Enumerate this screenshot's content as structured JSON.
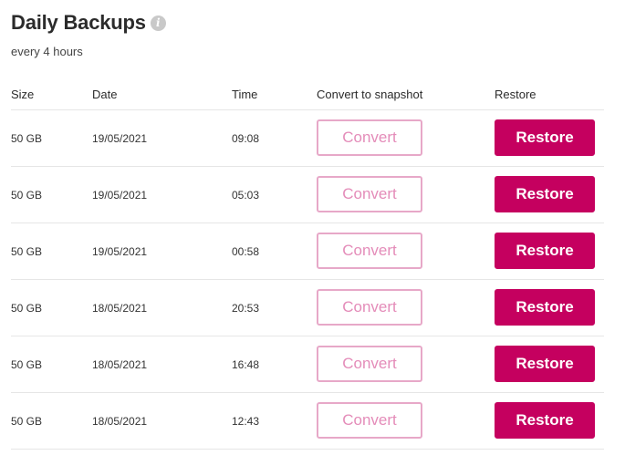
{
  "header": {
    "title": "Daily Backups",
    "info_icon": "info-icon",
    "subtitle": "every 4 hours"
  },
  "table": {
    "columns": {
      "size": "Size",
      "date": "Date",
      "time": "Time",
      "convert": "Convert to snapshot",
      "restore": "Restore"
    },
    "rows": [
      {
        "size": "50 GB",
        "date": "19/05/2021",
        "time": "09:08",
        "convert_label": "Convert",
        "restore_label": "Restore"
      },
      {
        "size": "50 GB",
        "date": "19/05/2021",
        "time": "05:03",
        "convert_label": "Convert",
        "restore_label": "Restore"
      },
      {
        "size": "50 GB",
        "date": "19/05/2021",
        "time": "00:58",
        "convert_label": "Convert",
        "restore_label": "Restore"
      },
      {
        "size": "50 GB",
        "date": "18/05/2021",
        "time": "20:53",
        "convert_label": "Convert",
        "restore_label": "Restore"
      },
      {
        "size": "50 GB",
        "date": "18/05/2021",
        "time": "16:48",
        "convert_label": "Convert",
        "restore_label": "Restore"
      },
      {
        "size": "50 GB",
        "date": "18/05/2021",
        "time": "12:43",
        "convert_label": "Convert",
        "restore_label": "Restore"
      }
    ]
  },
  "colors": {
    "accent": "#c5005f",
    "convert_border": "#e7a8c8",
    "convert_text": "#e48cb9"
  }
}
